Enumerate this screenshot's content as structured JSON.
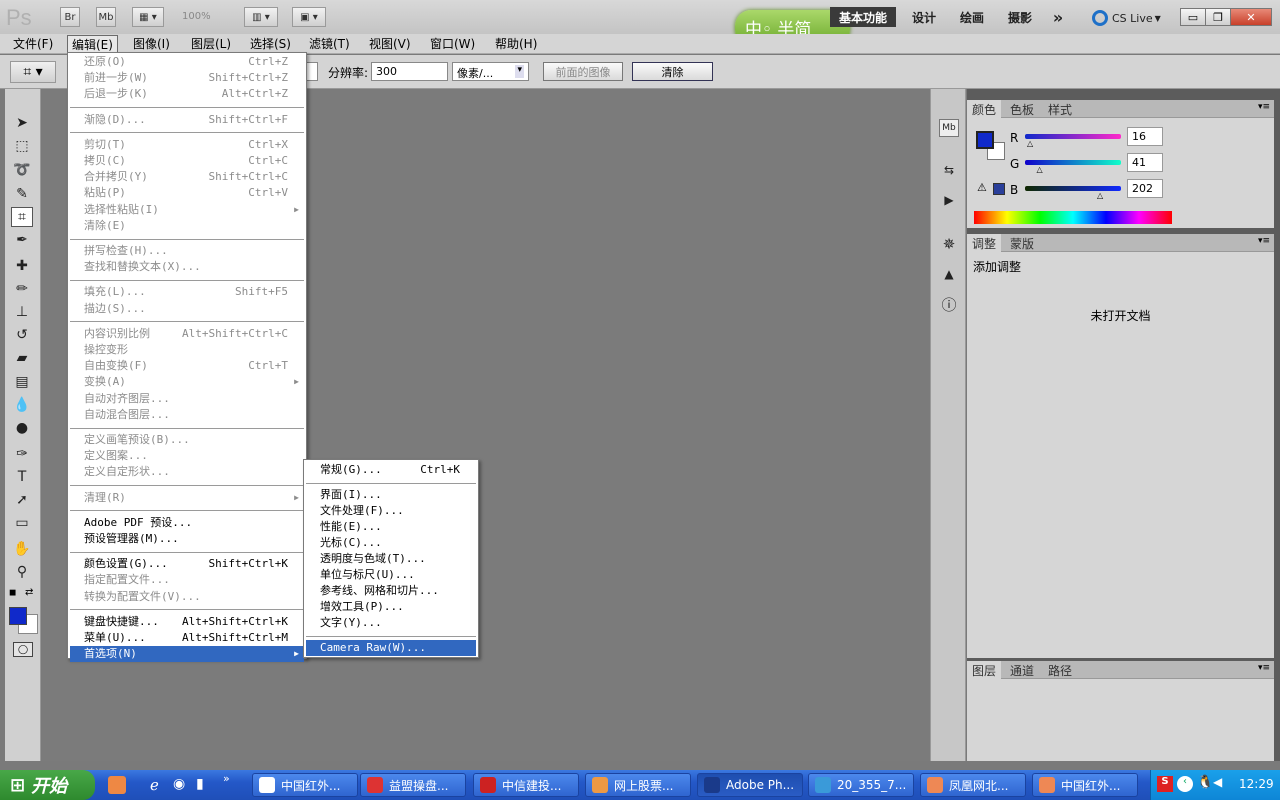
{
  "app": {
    "logo": "Ps",
    "br": "Br",
    "mb": "Mb",
    "zoom": "100%"
  },
  "ime": {
    "label": "中◦ 半简"
  },
  "workspaces": [
    "基本功能",
    "设计",
    "绘画",
    "摄影"
  ],
  "overflow": "»",
  "cslive": "CS Live",
  "window_buttons": [
    "▭",
    "❐",
    "✕"
  ],
  "menus": [
    "文件(F)",
    "编辑(E)",
    "图像(I)",
    "图层(L)",
    "选择(S)",
    "滤镜(T)",
    "视图(V)",
    "窗口(W)",
    "帮助(H)"
  ],
  "options": {
    "res_label": "分辨率:",
    "res_value": "300",
    "unit": "像素/...",
    "front_image": "前面的图像",
    "clear": "清除"
  },
  "edit_menu": [
    {
      "t": "还原(O)",
      "s": "Ctrl+Z",
      "d": true
    },
    {
      "t": "前进一步(W)",
      "s": "Shift+Ctrl+Z",
      "d": true
    },
    {
      "t": "后退一步(K)",
      "s": "Alt+Ctrl+Z",
      "d": true
    },
    {
      "sep": true
    },
    {
      "t": "渐隐(D)...",
      "s": "Shift+Ctrl+F",
      "d": true
    },
    {
      "sep": true
    },
    {
      "t": "剪切(T)",
      "s": "Ctrl+X",
      "d": true
    },
    {
      "t": "拷贝(C)",
      "s": "Ctrl+C",
      "d": true
    },
    {
      "t": "合并拷贝(Y)",
      "s": "Shift+Ctrl+C",
      "d": true
    },
    {
      "t": "粘贴(P)",
      "s": "Ctrl+V",
      "d": true
    },
    {
      "t": "选择性粘贴(I)",
      "s": "",
      "d": true,
      "sub": true
    },
    {
      "t": "清除(E)",
      "s": "",
      "d": true
    },
    {
      "sep": true
    },
    {
      "t": "拼写检查(H)...",
      "s": "",
      "d": true
    },
    {
      "t": "查找和替换文本(X)...",
      "s": "",
      "d": true
    },
    {
      "sep": true
    },
    {
      "t": "填充(L)...",
      "s": "Shift+F5",
      "d": true
    },
    {
      "t": "描边(S)...",
      "s": "",
      "d": true
    },
    {
      "sep": true
    },
    {
      "t": "内容识别比例",
      "s": "Alt+Shift+Ctrl+C",
      "d": true
    },
    {
      "t": "操控变形",
      "s": "",
      "d": true
    },
    {
      "t": "自由变换(F)",
      "s": "Ctrl+T",
      "d": true
    },
    {
      "t": "变换(A)",
      "s": "",
      "d": true,
      "sub": true
    },
    {
      "t": "自动对齐图层...",
      "s": "",
      "d": true
    },
    {
      "t": "自动混合图层...",
      "s": "",
      "d": true
    },
    {
      "sep": true
    },
    {
      "t": "定义画笔预设(B)...",
      "s": "",
      "d": true
    },
    {
      "t": "定义图案...",
      "s": "",
      "d": true
    },
    {
      "t": "定义自定形状...",
      "s": "",
      "d": true
    },
    {
      "sep": true
    },
    {
      "t": "清理(R)",
      "s": "",
      "d": true,
      "sub": true
    },
    {
      "sep": true
    },
    {
      "t": "Adobe PDF 预设...",
      "s": "",
      "d": false
    },
    {
      "t": "预设管理器(M)...",
      "s": "",
      "d": false
    },
    {
      "sep": true
    },
    {
      "t": "颜色设置(G)...",
      "s": "Shift+Ctrl+K",
      "d": false
    },
    {
      "t": "指定配置文件...",
      "s": "",
      "d": true
    },
    {
      "t": "转换为配置文件(V)...",
      "s": "",
      "d": true
    },
    {
      "sep": true
    },
    {
      "t": "键盘快捷键...",
      "s": "Alt+Shift+Ctrl+K",
      "d": false
    },
    {
      "t": "菜单(U)...",
      "s": "Alt+Shift+Ctrl+M",
      "d": false
    },
    {
      "t": "首选项(N)",
      "s": "",
      "d": false,
      "sub": true,
      "hl": true
    }
  ],
  "prefs_menu": [
    {
      "t": "常规(G)...",
      "s": "Ctrl+K"
    },
    {
      "sep": true
    },
    {
      "t": "界面(I)...",
      "s": ""
    },
    {
      "t": "文件处理(F)...",
      "s": ""
    },
    {
      "t": "性能(E)...",
      "s": ""
    },
    {
      "t": "光标(C)...",
      "s": ""
    },
    {
      "t": "透明度与色域(T)...",
      "s": ""
    },
    {
      "t": "单位与标尺(U)...",
      "s": ""
    },
    {
      "t": "参考线、网格和切片...",
      "s": ""
    },
    {
      "t": "增效工具(P)...",
      "s": ""
    },
    {
      "t": "文字(Y)...",
      "s": ""
    },
    {
      "sep": true
    },
    {
      "t": "Camera Raw(W)...",
      "s": "",
      "hl": true
    }
  ],
  "color_panel": {
    "tabs": [
      "颜色",
      "色板",
      "样式"
    ],
    "r_label": "R",
    "g_label": "G",
    "b_label": "B",
    "r": "16",
    "g": "41",
    "b": "202",
    "r_frac": 0.063,
    "g_frac": 0.161,
    "b_frac": 0.792,
    "fg": "#1029ca"
  },
  "adjust_panel": {
    "tabs": [
      "调整",
      "蒙版"
    ],
    "title": "添加调整",
    "empty": "未打开文档"
  },
  "layers_panel": {
    "tabs": [
      "图层",
      "通道",
      "路径"
    ]
  },
  "taskbar": {
    "start": "开始",
    "tasks": [
      "中国红外...",
      "益盟操盘...",
      "中信建投...",
      "网上股票...",
      "Adobe Ph...",
      "20_355_7...",
      "凤凰网北...",
      "中国红外..."
    ],
    "clock": "12:29"
  }
}
